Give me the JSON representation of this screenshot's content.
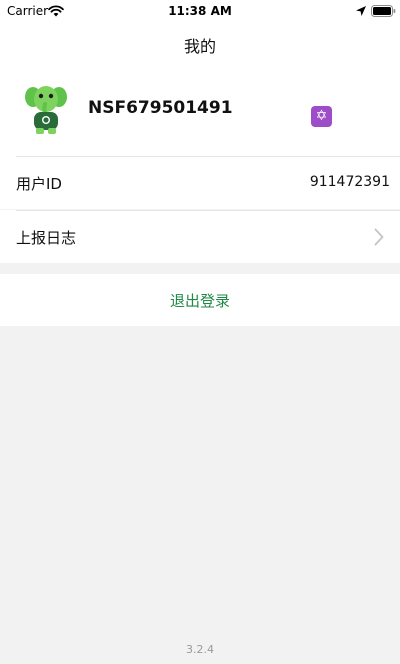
{
  "status_bar": {
    "carrier": "Carrier",
    "time": "11:38 AM"
  },
  "nav": {
    "title": "我的"
  },
  "profile": {
    "username": "NSF679501491",
    "badge_icon": "star-of-david-icon",
    "badge_glyph": "✡",
    "badge_color": "#9c4dc7"
  },
  "rows": {
    "user_id_label": "用户ID",
    "user_id_value": "911472391",
    "report_log_label": "上报日志"
  },
  "logout": {
    "label": "退出登录",
    "color": "#1f8a44"
  },
  "version": "3.2.4"
}
